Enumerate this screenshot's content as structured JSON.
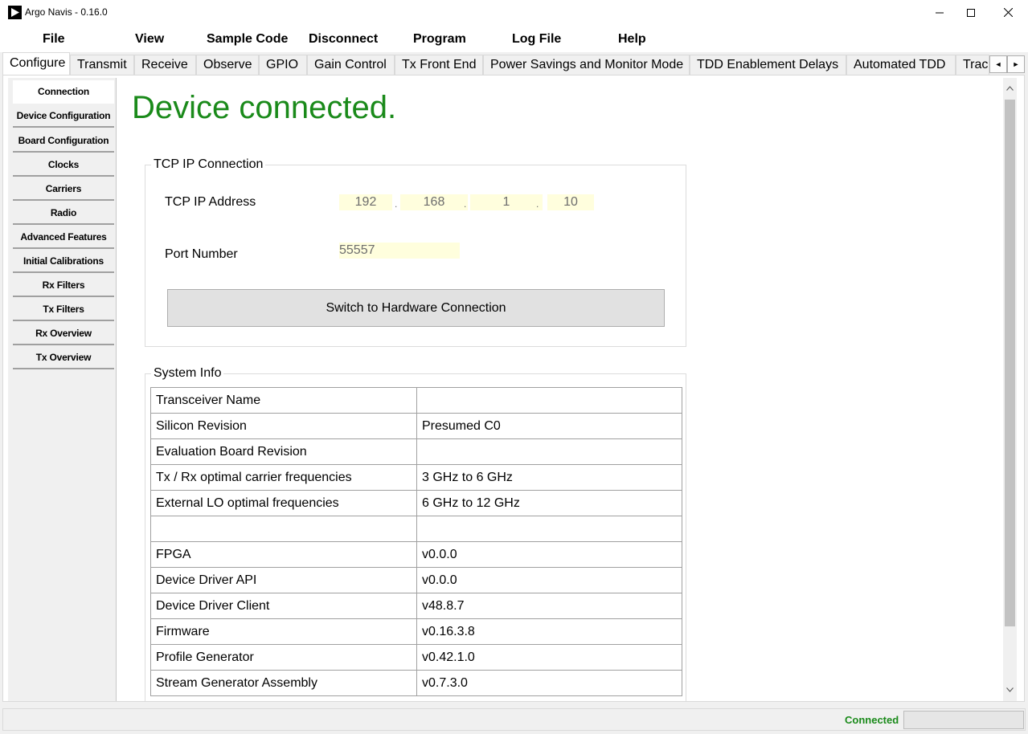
{
  "window": {
    "title": "Argo Navis - 0.16.0",
    "minimize_icon": "minimize-icon",
    "maximize_icon": "maximize-icon",
    "close_icon": "close-icon"
  },
  "menu": {
    "items": [
      "File",
      "View",
      "Sample Code",
      "Disconnect",
      "Program",
      "Log File",
      "Help"
    ]
  },
  "tabs": {
    "items": [
      "Configure",
      "Transmit",
      "Receive",
      "Observe",
      "GPIO",
      "Gain Control",
      "Tx Front End",
      "Power Savings and Monitor Mode",
      "TDD Enablement Delays",
      "Automated TDD",
      "Trac"
    ],
    "active": "Configure",
    "scroll_left": "◄",
    "scroll_right": "►"
  },
  "sidebar": {
    "items": [
      "Connection",
      "Device Configuration",
      "Board Configuration",
      "Clocks",
      "Carriers",
      "Radio",
      "Advanced Features",
      "Initial Calibrations",
      "Rx Filters",
      "Tx Filters",
      "Rx Overview",
      "Tx Overview"
    ],
    "active": "Connection"
  },
  "main": {
    "status_heading": "Device connected.",
    "status_color": "#1a8a1a",
    "tcp": {
      "group_title": "TCP IP Connection",
      "ip_label": "TCP IP Address",
      "ip_octets": [
        "192",
        "168",
        "1",
        "10"
      ],
      "port_label": "Port Number",
      "port_value": "55557",
      "switch_button": "Switch to Hardware Connection"
    },
    "system_info": {
      "group_title": "System Info",
      "rows": [
        [
          "Transceiver Name",
          ""
        ],
        [
          "Silicon Revision",
          "Presumed C0"
        ],
        [
          "Evaluation Board Revision",
          ""
        ],
        [
          "Tx / Rx optimal carrier frequencies",
          "3 GHz to 6 GHz"
        ],
        [
          "External LO optimal frequencies",
          "6 GHz to 12 GHz"
        ],
        [
          "",
          ""
        ],
        [
          "FPGA",
          "v0.0.0"
        ],
        [
          "Device Driver API",
          "v0.0.0"
        ],
        [
          "Device Driver Client",
          "v48.8.7"
        ],
        [
          "Firmware",
          "v0.16.3.8"
        ],
        [
          "Profile Generator",
          "v0.42.1.0"
        ],
        [
          "Stream Generator Assembly",
          "v0.7.3.0"
        ]
      ]
    }
  },
  "statusbar": {
    "connection_text": "Connected"
  }
}
